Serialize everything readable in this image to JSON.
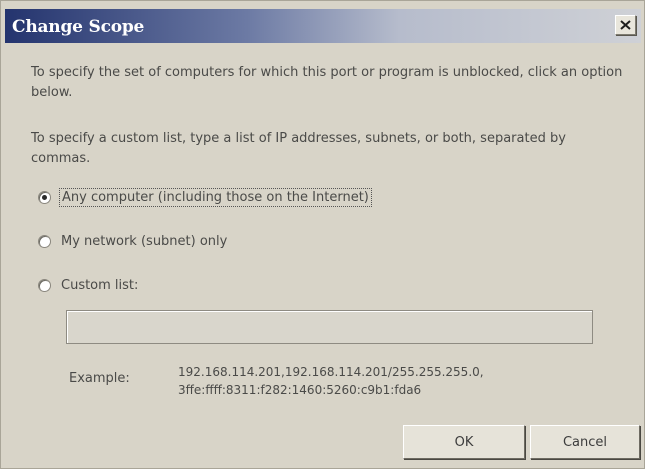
{
  "window": {
    "title": "Change Scope",
    "close_icon": "close-icon"
  },
  "instructions": {
    "line1": "To specify the set of computers for which this port or program is unblocked, click an option below.",
    "line2": "To specify a custom list, type a list of IP addresses, subnets, or both, separated by commas."
  },
  "scope_options": [
    {
      "label": "Any computer (including those on the Internet)",
      "selected": true
    },
    {
      "label": "My network (subnet) only",
      "selected": false
    },
    {
      "label": "Custom list:",
      "selected": false
    }
  ],
  "custom_list": {
    "value": "",
    "example_label": "Example:",
    "example_text": "192.168.114.201,192.168.114.201/255.255.255.0, 3ffe:ffff:8311:f282:1460:5260:c9b1:fda6"
  },
  "buttons": {
    "ok_label": "OK",
    "cancel_label": "Cancel"
  }
}
